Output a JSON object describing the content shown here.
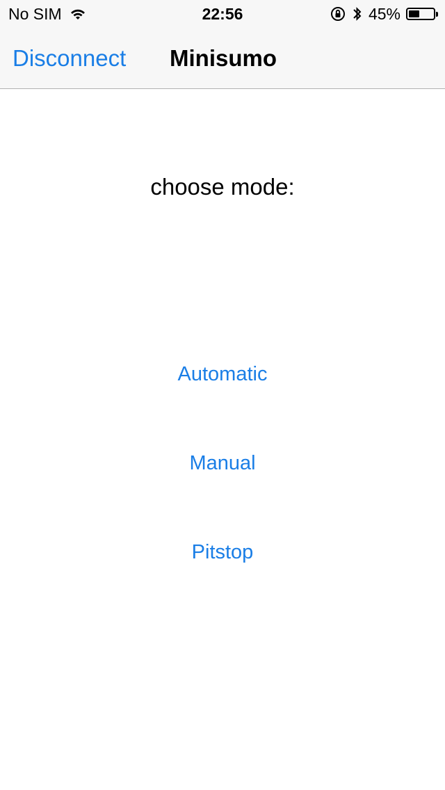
{
  "status_bar": {
    "carrier": "No SIM",
    "time": "22:56",
    "battery_percent": "45%",
    "battery_level": 0.45,
    "icons": [
      "wifi-icon",
      "rotation-lock-icon",
      "bluetooth-icon",
      "battery-icon"
    ]
  },
  "nav": {
    "back_label": "Disconnect",
    "title": "Minisumo"
  },
  "main": {
    "prompt": "choose mode:",
    "modes": [
      "Automatic",
      "Manual",
      "Pitstop"
    ]
  },
  "colors": {
    "accent": "#1a7ee6",
    "bar_background": "#f7f7f7"
  }
}
